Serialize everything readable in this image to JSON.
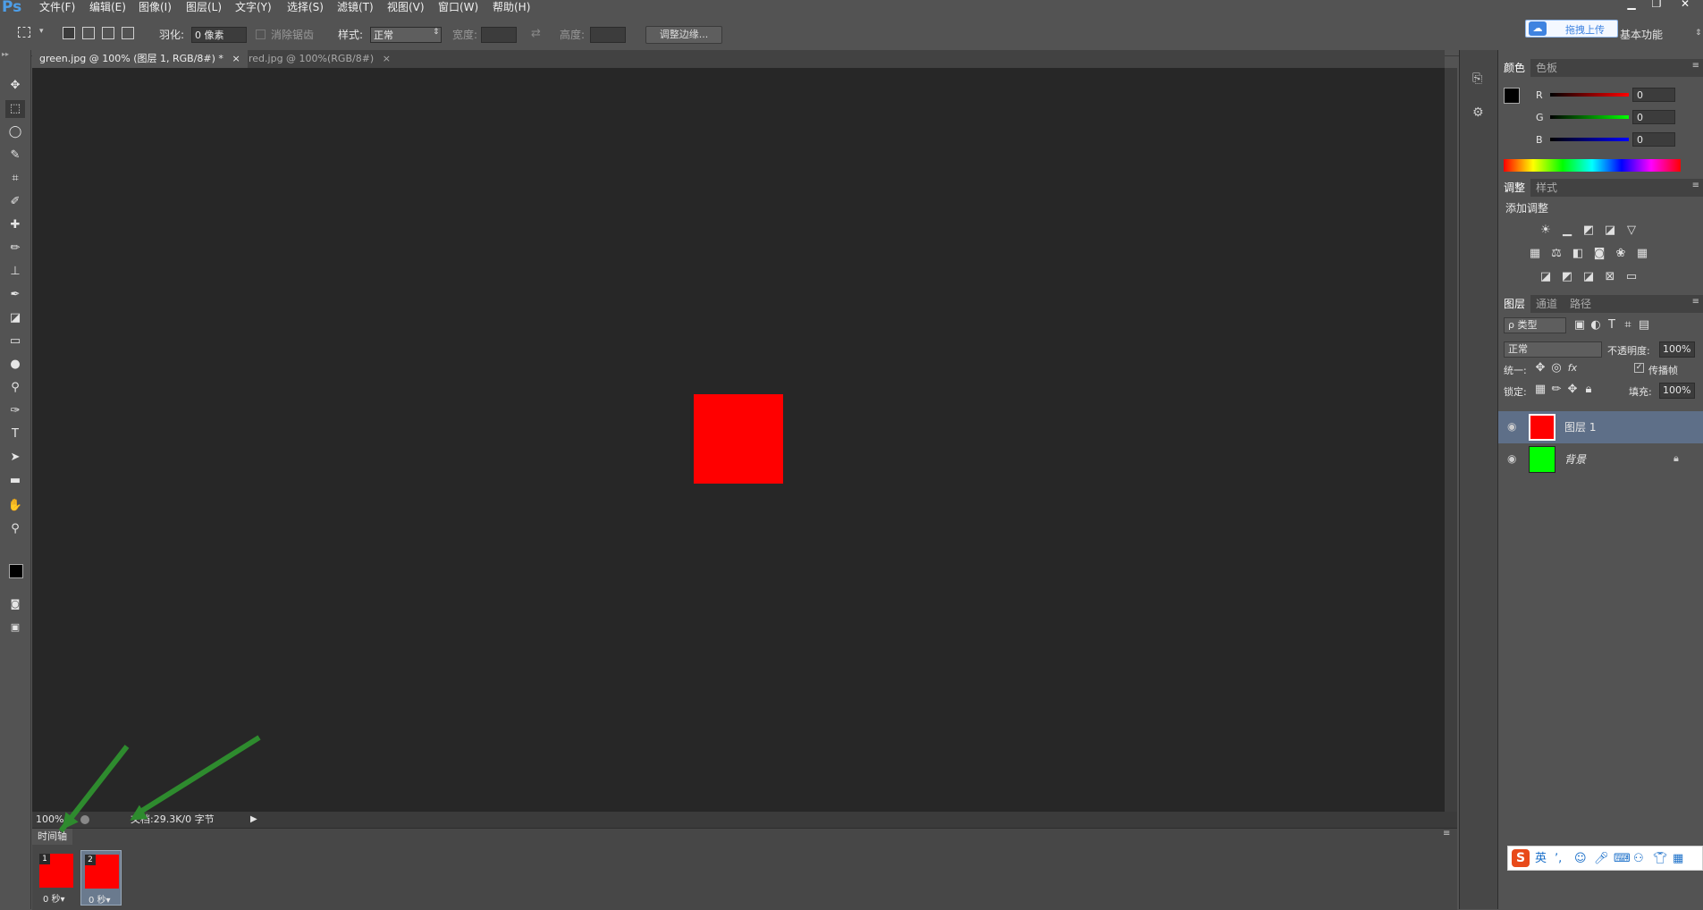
{
  "app": {
    "logo": "Ps"
  },
  "menu": [
    "文件(F)",
    "编辑(E)",
    "图像(I)",
    "图层(L)",
    "文字(Y)",
    "选择(S)",
    "滤镜(T)",
    "视图(V)",
    "窗口(W)",
    "帮助(H)"
  ],
  "window_controls": {
    "minimize": "▁",
    "restore": "❐",
    "close": "✕"
  },
  "options": {
    "feather_label": "羽化:",
    "feather_value": "0 像素",
    "antialias_label": "消除锯齿",
    "style_label": "样式:",
    "style_value": "正常",
    "width_label": "宽度:",
    "height_label": "高度:",
    "refine_edge_button": "调整边缘...",
    "upload_button": "拖拽上传",
    "workspace": "基本功能"
  },
  "tabs": [
    {
      "label": "green.jpg @ 100% (图层 1, RGB/8#) *",
      "close": "×",
      "active": true
    },
    {
      "label": "red.jpg @ 100%(RGB/8#)",
      "close": "×",
      "active": false
    }
  ],
  "status": {
    "zoom": "100%",
    "doc_info": "文档:29.3K/0 字节"
  },
  "timeline": {
    "title": "时间轴",
    "frames": [
      {
        "num": "1",
        "duration": "0 秒▾"
      },
      {
        "num": "2",
        "duration": "0 秒▾"
      }
    ]
  },
  "color_panel": {
    "tabs": [
      "颜色",
      "色板"
    ],
    "channels": [
      {
        "label": "R",
        "value": "0"
      },
      {
        "label": "G",
        "value": "0"
      },
      {
        "label": "B",
        "value": "0"
      }
    ]
  },
  "adjust_panel": {
    "tabs": [
      "调整",
      "样式"
    ],
    "title": "添加调整"
  },
  "layers_panel": {
    "tabs": [
      "图层",
      "通道",
      "路径"
    ],
    "filter_label": "ρ 类型",
    "blend_mode": "正常",
    "opacity_label": "不透明度:",
    "opacity_value": "100%",
    "unify_label": "统一:",
    "propagate_label": "传播帧",
    "lock_label": "锁定:",
    "fill_label": "填充:",
    "fill_value": "100%",
    "layers": [
      {
        "name": "图层 1",
        "color": "#ff0000",
        "selected": true
      },
      {
        "name": "背景",
        "color": "#00ff00",
        "selected": false
      }
    ]
  },
  "ime": {
    "logo": "S",
    "lang": "英"
  },
  "colors": {
    "accent_blue": "#4d9ee8",
    "red": "#ff0000",
    "green": "#00ff00",
    "arrow": "#2e8b2e"
  }
}
